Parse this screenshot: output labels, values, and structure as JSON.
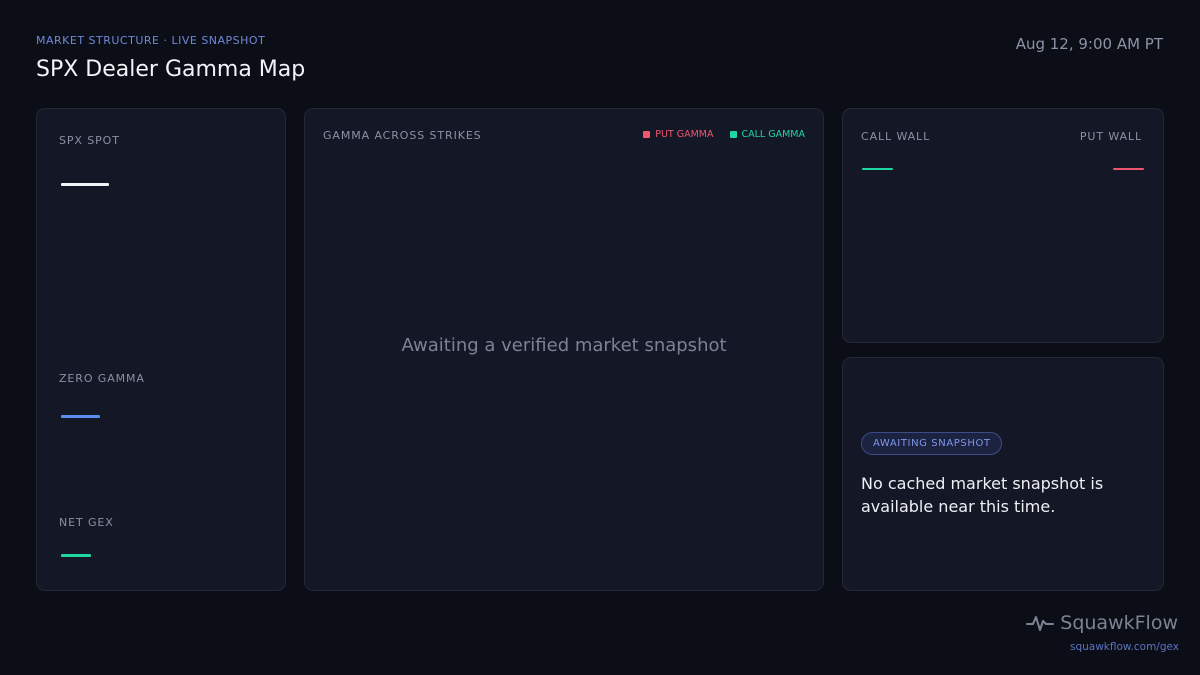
{
  "header": {
    "eyebrow": "MARKET STRUCTURE · LIVE SNAPSHOT",
    "title": "SPX Dealer Gamma Map",
    "timestamp": "Aug 12, 9:00 AM PT"
  },
  "stats": {
    "spot_label": "SPX SPOT",
    "zero_gamma_label": "ZERO GAMMA",
    "net_gex_label": "NET GEX"
  },
  "chart": {
    "title": "GAMMA ACROSS STRIKES",
    "legend": [
      {
        "label": "PUT GAMMA",
        "color": "#f0556e"
      },
      {
        "label": "CALL GAMMA",
        "color": "#1fd6a0"
      }
    ],
    "placeholder": "Awaiting a verified market snapshot"
  },
  "walls": {
    "call_label": "CALL WALL",
    "put_label": "PUT WALL"
  },
  "status": {
    "badge": "AWAITING SNAPSHOT",
    "message": "No cached market snapshot is available near this time."
  },
  "brand": {
    "name": "SquawkFlow",
    "url": "squawkflow.com/gex"
  },
  "colors": {
    "accent": "#6e88d8",
    "spot": "#f2f4f8",
    "zero_gamma": "#5a8ff0",
    "positive": "#1fd6a0",
    "negative": "#f0556e"
  }
}
